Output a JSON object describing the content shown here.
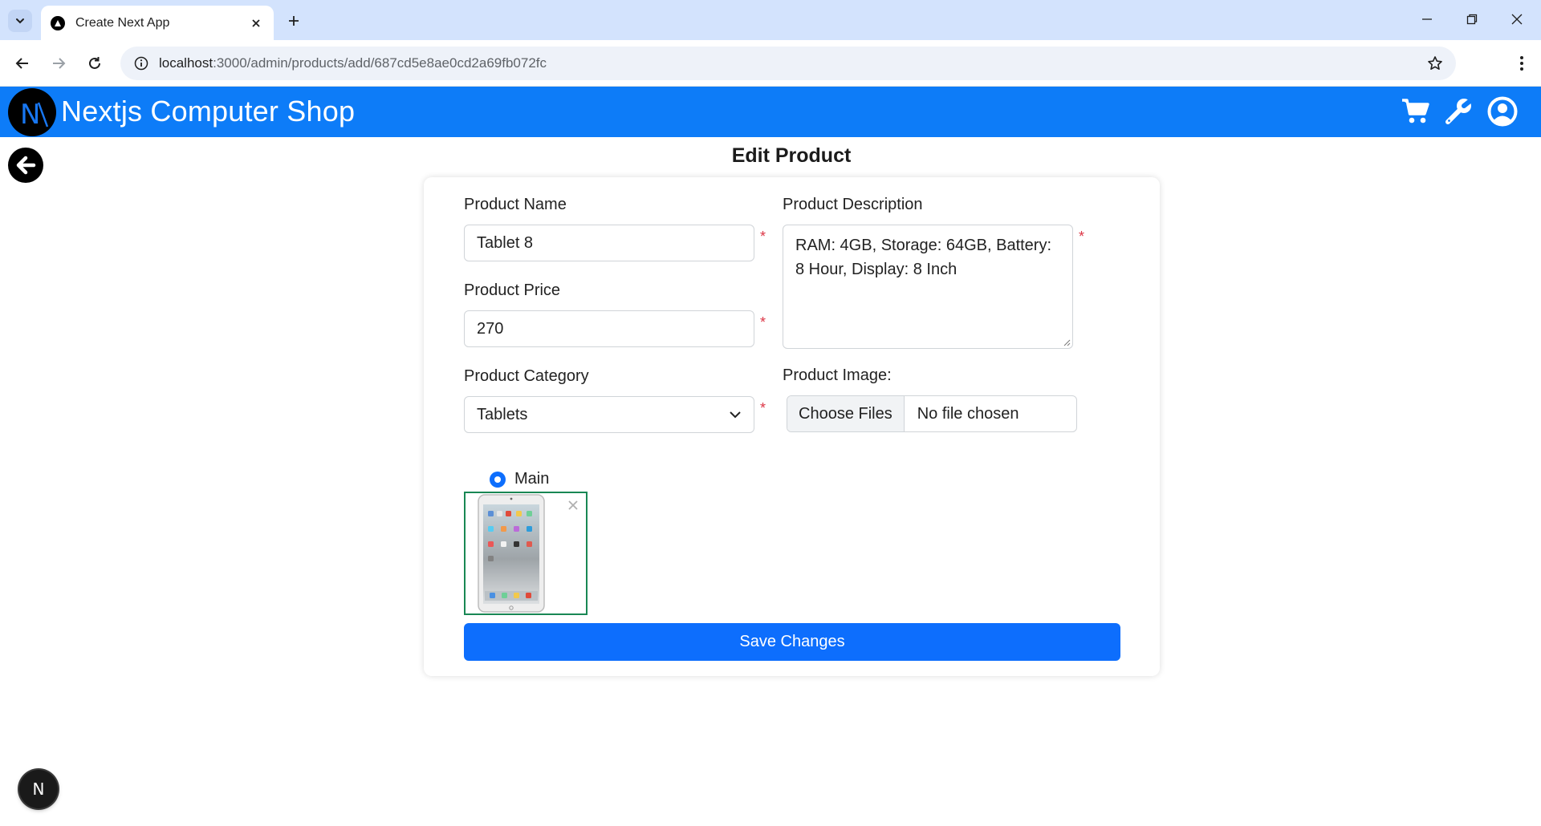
{
  "browser": {
    "tab_title": "Create Next App",
    "url_host": "localhost",
    "url_path": ":3000/admin/products/add/687cd5e8ae0cd2a69fb072fc"
  },
  "navbar": {
    "brand": "Nextjs Computer Shop",
    "logo_letter": "N",
    "icons": [
      "cart-icon",
      "wrench-icon",
      "user-circle-icon"
    ],
    "color": "#0d7cf8"
  },
  "page": {
    "title": "Edit Product"
  },
  "form": {
    "name_label": "Product Name",
    "name_value": "Tablet 8",
    "price_label": "Product Price",
    "price_value": "270",
    "category_label": "Product Category",
    "category_value": "Tablets",
    "description_label": "Product Description",
    "description_value": "RAM: 4GB, Storage: 64GB, Battery: 8 Hour, Display: 8 Inch",
    "image_label": "Product Image:",
    "file_button": "Choose Files",
    "file_status": "No file chosen",
    "required_mark": "*",
    "main_radio_label": "Main",
    "save_label": "Save Changes"
  },
  "dev": {
    "badge_letter": "N"
  }
}
